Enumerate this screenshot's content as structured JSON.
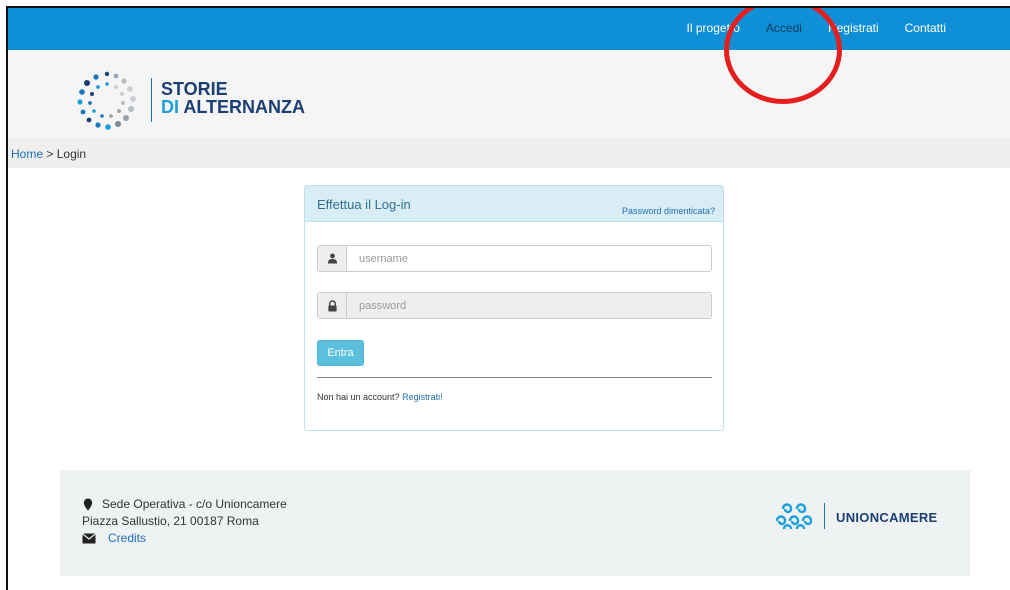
{
  "nav": {
    "items": [
      {
        "label": "Il progetto"
      },
      {
        "label": "Accedi"
      },
      {
        "label": "Registrati"
      },
      {
        "label": "Contatti"
      }
    ]
  },
  "brand": {
    "line1": "STORIE",
    "line2_di": "DI",
    "line2_rest": "ALTERNANZA"
  },
  "breadcrumb": {
    "home": "Home",
    "separator": ">",
    "current": "Login"
  },
  "login": {
    "title": "Effettua il Log-in",
    "forgot_link": "Password dimenticata?",
    "username_placeholder": "username",
    "password_placeholder": "password",
    "submit_label": "Entra",
    "no_account_text": "Non hai un account?",
    "register_link": "Registrati!"
  },
  "footer": {
    "address_line1": "Sede Operativa - c/o Unioncamere",
    "address_line2": "Piazza Sallustio, 21 00187 Roma",
    "credits_label": "Credits",
    "partner_name": "UNIONCAMERE"
  },
  "colors": {
    "nav_bg": "#0f90d6",
    "accent_link": "#1f6fb5",
    "panel_header": "#d9edf7",
    "button_info": "#5bc0de",
    "annotation_circle": "#e61e1e"
  },
  "icons": [
    "user-icon",
    "lock-icon",
    "map-marker-icon",
    "envelope-icon"
  ]
}
